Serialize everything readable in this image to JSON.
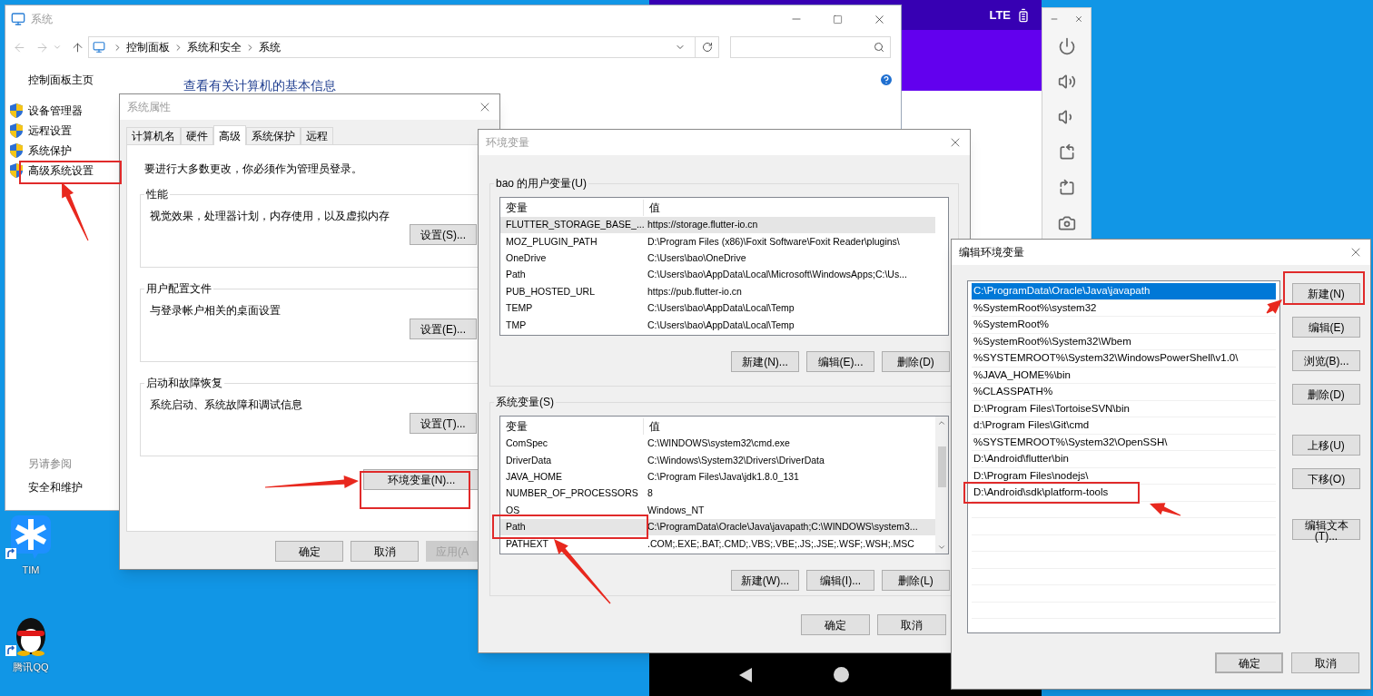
{
  "system_window": {
    "title": "系统",
    "breadcrumb": [
      "控制面板",
      "系统和安全",
      "系统"
    ],
    "nav_items": [
      {
        "label": "控制面板主页",
        "kind": "home"
      },
      {
        "label": "设备管理器",
        "kind": "shield"
      },
      {
        "label": "远程设置",
        "kind": "shield"
      },
      {
        "label": "系统保护",
        "kind": "shield"
      },
      {
        "label": "高级系统设置",
        "kind": "shield"
      }
    ],
    "heading": "查看有关计算机的基本信息",
    "see_also": {
      "title": "另请参阅",
      "links": [
        "安全和维护"
      ]
    }
  },
  "system_properties": {
    "title": "系统属性",
    "tabs": [
      {
        "label": "计算机名",
        "selected": false
      },
      {
        "label": "硬件",
        "selected": false
      },
      {
        "label": "高级",
        "selected": true
      },
      {
        "label": "系统保护",
        "selected": false
      },
      {
        "label": "远程",
        "selected": false
      }
    ],
    "notice": "要进行大多数更改，你必须作为管理员登录。",
    "groups": [
      {
        "title": "性能",
        "description": "视觉效果，处理器计划，内存使用，以及虚拟内存",
        "button": "设置(S)..."
      },
      {
        "title": "用户配置文件",
        "description": "与登录帐户相关的桌面设置",
        "button": "设置(E)..."
      },
      {
        "title": "启动和故障恢复",
        "description": "系统启动、系统故障和调试信息",
        "button": "设置(T)..."
      }
    ],
    "env_button": "环境变量(N)...",
    "buttons": [
      {
        "label": "确定",
        "disabled": false
      },
      {
        "label": "取消",
        "disabled": false
      },
      {
        "label": "应用(A",
        "disabled": true
      }
    ]
  },
  "environment_variables": {
    "title": "环境变量",
    "user_vars": {
      "title": "bao 的用户变量(U)",
      "columns": [
        "变量",
        "值"
      ],
      "rows": [
        {
          "name": "FLUTTER_STORAGE_BASE_...",
          "value": "https://storage.flutter-io.cn",
          "selected": true
        },
        {
          "name": "MOZ_PLUGIN_PATH",
          "value": "D:\\Program Files (x86)\\Foxit Software\\Foxit Reader\\plugins\\",
          "selected": false
        },
        {
          "name": "OneDrive",
          "value": "C:\\Users\\bao\\OneDrive",
          "selected": false
        },
        {
          "name": "Path",
          "value": "C:\\Users\\bao\\AppData\\Local\\Microsoft\\WindowsApps;C:\\Us...",
          "selected": false
        },
        {
          "name": "PUB_HOSTED_URL",
          "value": "https://pub.flutter-io.cn",
          "selected": false
        },
        {
          "name": "TEMP",
          "value": "C:\\Users\\bao\\AppData\\Local\\Temp",
          "selected": false
        },
        {
          "name": "TMP",
          "value": "C:\\Users\\bao\\AppData\\Local\\Temp",
          "selected": false
        }
      ],
      "buttons": [
        "新建(N)...",
        "编辑(E)...",
        "删除(D)"
      ]
    },
    "system_vars": {
      "title": "系统变量(S)",
      "columns": [
        "变量",
        "值"
      ],
      "rows": [
        {
          "name": "ComSpec",
          "value": "C:\\WINDOWS\\system32\\cmd.exe",
          "selected": false
        },
        {
          "name": "DriverData",
          "value": "C:\\Windows\\System32\\Drivers\\DriverData",
          "selected": false
        },
        {
          "name": "JAVA_HOME",
          "value": "C:\\Program Files\\Java\\jdk1.8.0_131",
          "selected": false
        },
        {
          "name": "NUMBER_OF_PROCESSORS",
          "value": "8",
          "selected": false
        },
        {
          "name": "OS",
          "value": "Windows_NT",
          "selected": false
        },
        {
          "name": "Path",
          "value": "C:\\ProgramData\\Oracle\\Java\\javapath;C:\\WINDOWS\\system3...",
          "selected": true
        },
        {
          "name": "PATHEXT",
          "value": ".COM;.EXE;.BAT;.CMD;.VBS;.VBE;.JS;.JSE;.WSF;.WSH;.MSC",
          "selected": false
        }
      ],
      "buttons": [
        "新建(W)...",
        "编辑(I)...",
        "删除(L)"
      ]
    },
    "buttons": [
      "确定",
      "取消"
    ]
  },
  "edit_variable": {
    "title": "编辑环境变量",
    "entries": [
      {
        "text": "C:\\ProgramData\\Oracle\\Java\\javapath",
        "selected": true
      },
      {
        "text": "%SystemRoot%\\system32",
        "selected": false
      },
      {
        "text": "%SystemRoot%",
        "selected": false
      },
      {
        "text": "%SystemRoot%\\System32\\Wbem",
        "selected": false
      },
      {
        "text": "%SYSTEMROOT%\\System32\\WindowsPowerShell\\v1.0\\",
        "selected": false
      },
      {
        "text": "%JAVA_HOME%\\bin",
        "selected": false
      },
      {
        "text": "%CLASSPATH%",
        "selected": false
      },
      {
        "text": "D:\\Program Files\\TortoiseSVN\\bin",
        "selected": false
      },
      {
        "text": "d:\\Program Files\\Git\\cmd",
        "selected": false
      },
      {
        "text": "%SYSTEMROOT%\\System32\\OpenSSH\\",
        "selected": false
      },
      {
        "text": "D:\\Android\\flutter\\bin",
        "selected": false
      },
      {
        "text": "D:\\Program Files\\nodejs\\",
        "selected": false
      },
      {
        "text": "D:\\Android\\sdk\\platform-tools",
        "selected": false
      }
    ],
    "side_buttons": [
      "新建(N)",
      "编辑(E)",
      "浏览(B)...",
      "删除(D)",
      "上移(U)",
      "下移(O)",
      "编辑文本(T)..."
    ],
    "footer_buttons": [
      {
        "label": "确定",
        "default": true
      },
      {
        "label": "取消",
        "default": false
      }
    ]
  },
  "emulator": {
    "network": "LTE"
  },
  "desktop_icons": [
    {
      "label": "TIM",
      "kind": "tim"
    },
    {
      "label": "腾讯QQ",
      "kind": "qq"
    }
  ]
}
